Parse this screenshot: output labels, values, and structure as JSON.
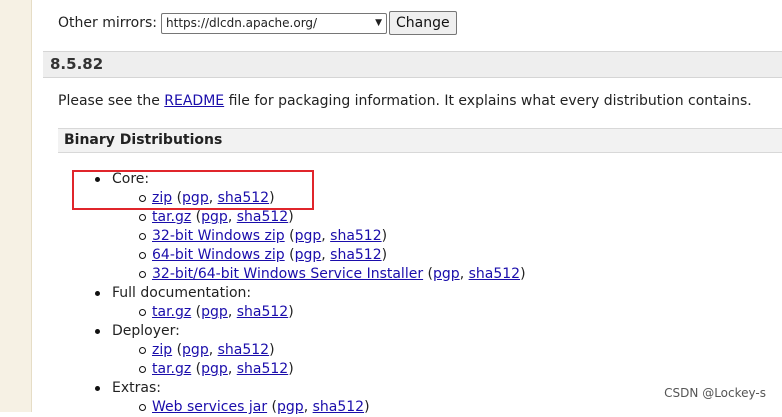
{
  "mirror": {
    "label": "Other mirrors:",
    "selected": "https://dlcdn.apache.org/",
    "button_label": "Change"
  },
  "version": {
    "title": "8.5.82"
  },
  "readme": {
    "before": "Please see the ",
    "link": "README",
    "after": " file for packaging information. It explains what every distribution contains."
  },
  "binary": {
    "title": "Binary Distributions",
    "groups": [
      {
        "label": "Core:",
        "items": [
          {
            "main": "zip",
            "pgp": "pgp",
            "sha": "sha512"
          },
          {
            "main": "tar.gz",
            "pgp": "pgp",
            "sha": "sha512"
          },
          {
            "main": "32-bit Windows zip",
            "pgp": "pgp",
            "sha": "sha512"
          },
          {
            "main": "64-bit Windows zip",
            "pgp": "pgp",
            "sha": "sha512"
          },
          {
            "main": "32-bit/64-bit Windows Service Installer",
            "pgp": "pgp",
            "sha": "sha512"
          }
        ]
      },
      {
        "label": "Full documentation:",
        "items": [
          {
            "main": "tar.gz",
            "pgp": "pgp",
            "sha": "sha512"
          }
        ]
      },
      {
        "label": "Deployer:",
        "items": [
          {
            "main": "zip",
            "pgp": "pgp",
            "sha": "sha512"
          },
          {
            "main": "tar.gz",
            "pgp": "pgp",
            "sha": "sha512"
          }
        ]
      },
      {
        "label": "Extras:",
        "items": [
          {
            "main": "Web services jar",
            "pgp": "pgp",
            "sha": "sha512"
          }
        ]
      }
    ]
  },
  "annotation": {
    "highlight_color": "#e0252b"
  },
  "watermark": "CSDN @Lockey-s"
}
